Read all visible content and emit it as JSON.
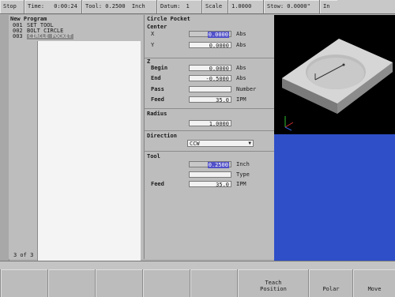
{
  "topbar": {
    "stop": "Stop",
    "time_label": "Time:",
    "time_value": "0:00:24",
    "tool_label": "Tool:",
    "tool_value": "0.2500",
    "tool_unit": "Inch",
    "datum_label": "Datum:",
    "datum_value": "1",
    "scale_label": "Scale",
    "scale_value": "1.0000",
    "stow_label": "Stow:",
    "stow_value": "0.0000\"",
    "inch_value": "In"
  },
  "program": {
    "title": "New Program",
    "rows": [
      {
        "num": "001",
        "text": "SET TOOL"
      },
      {
        "num": "002",
        "text": "BOLT CIRCLE"
      },
      {
        "num": "003",
        "text": "CIRCLE POCKET"
      }
    ],
    "count": "3 of 3"
  },
  "form": {
    "title": "Circle Pocket",
    "center": {
      "label": "Center",
      "x_label": "X",
      "x_value": "0.0000",
      "x_unit": "Abs",
      "y_label": "Y",
      "y_value": "0.0000",
      "y_unit": "Abs"
    },
    "z": {
      "label": "Z",
      "begin_label": "Begin",
      "begin_value": "0.0000",
      "begin_unit": "Abs",
      "end_label": "End",
      "end_value": "-0.5000",
      "end_unit": "Abs",
      "pass_label": "Pass",
      "pass_value": "",
      "pass_unit": "Number",
      "feed_label": "Feed",
      "feed_value": "35.0",
      "feed_unit": "IPM"
    },
    "radius": {
      "label": "Radius",
      "value": "1.0000"
    },
    "direction": {
      "label": "Direction",
      "value": "CCW"
    },
    "tool": {
      "label": "Tool",
      "dia_value": "0.2500",
      "dia_unit": "Inch",
      "type_value": "",
      "type_unit": "Type",
      "feed_label": "Feed",
      "feed_value": "35.0",
      "feed_unit": "IPM"
    }
  },
  "softkeys": {
    "teach_line1": "Teach",
    "teach_line2": "Position",
    "polar": "Polar",
    "move": "Move"
  },
  "colors": {
    "panel": "#bdbdbd",
    "view_bg": "#000000",
    "blue_area": "#2f4fc8",
    "highlight": "#5050c8"
  }
}
